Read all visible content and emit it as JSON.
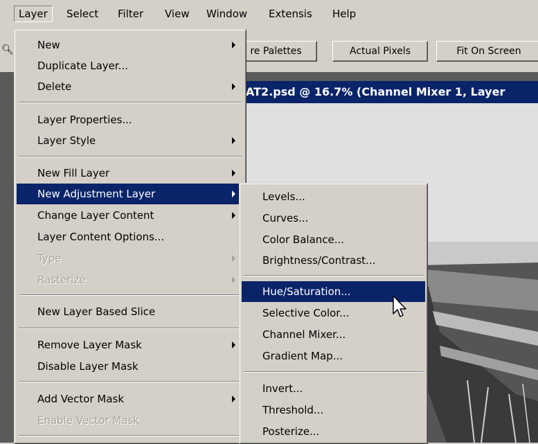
{
  "menubar": {
    "items": [
      "Layer",
      "Select",
      "Filter",
      "View",
      "Window",
      "Extensis",
      "Help"
    ]
  },
  "options": {
    "palettes_label": "re Palettes",
    "actual_pixels_label": "Actual Pixels",
    "fit_on_screen_label": "Fit On Screen"
  },
  "document": {
    "title": "AT2.psd @ 16.7% (Channel Mixer 1, Layer"
  },
  "layer_menu": {
    "items": [
      {
        "label": "New",
        "submenu": true
      },
      {
        "label": "Duplicate Layer..."
      },
      {
        "label": "Delete",
        "submenu": true
      },
      {
        "label": "Layer Properties..."
      },
      {
        "label": "Layer Style",
        "submenu": true
      },
      {
        "label": "New Fill Layer",
        "submenu": true
      },
      {
        "label": "New Adjustment Layer",
        "submenu": true,
        "highlighted": true
      },
      {
        "label": "Change Layer Content",
        "submenu": true
      },
      {
        "label": "Layer Content Options..."
      },
      {
        "label": "Type",
        "submenu": true,
        "disabled": true
      },
      {
        "label": "Rasterize",
        "submenu": true,
        "disabled": true
      },
      {
        "label": "New Layer Based Slice"
      },
      {
        "label": "Remove Layer Mask",
        "submenu": true
      },
      {
        "label": "Disable Layer Mask"
      },
      {
        "label": "Add Vector Mask",
        "submenu": true
      },
      {
        "label": "Enable Vector Mask",
        "disabled": true
      }
    ]
  },
  "adjustment_submenu": {
    "items": [
      {
        "label": "Levels..."
      },
      {
        "label": "Curves..."
      },
      {
        "label": "Color Balance..."
      },
      {
        "label": "Brightness/Contrast..."
      },
      {
        "label": "Hue/Saturation...",
        "highlighted": true
      },
      {
        "label": "Selective Color..."
      },
      {
        "label": "Channel Mixer..."
      },
      {
        "label": "Gradient Map..."
      },
      {
        "label": "Invert..."
      },
      {
        "label": "Threshold..."
      },
      {
        "label": "Posterize..."
      }
    ]
  },
  "colors": {
    "menu_bg": "#d4d0c8",
    "highlight": "#0a246a",
    "disabled_text": "#a8a49c"
  }
}
